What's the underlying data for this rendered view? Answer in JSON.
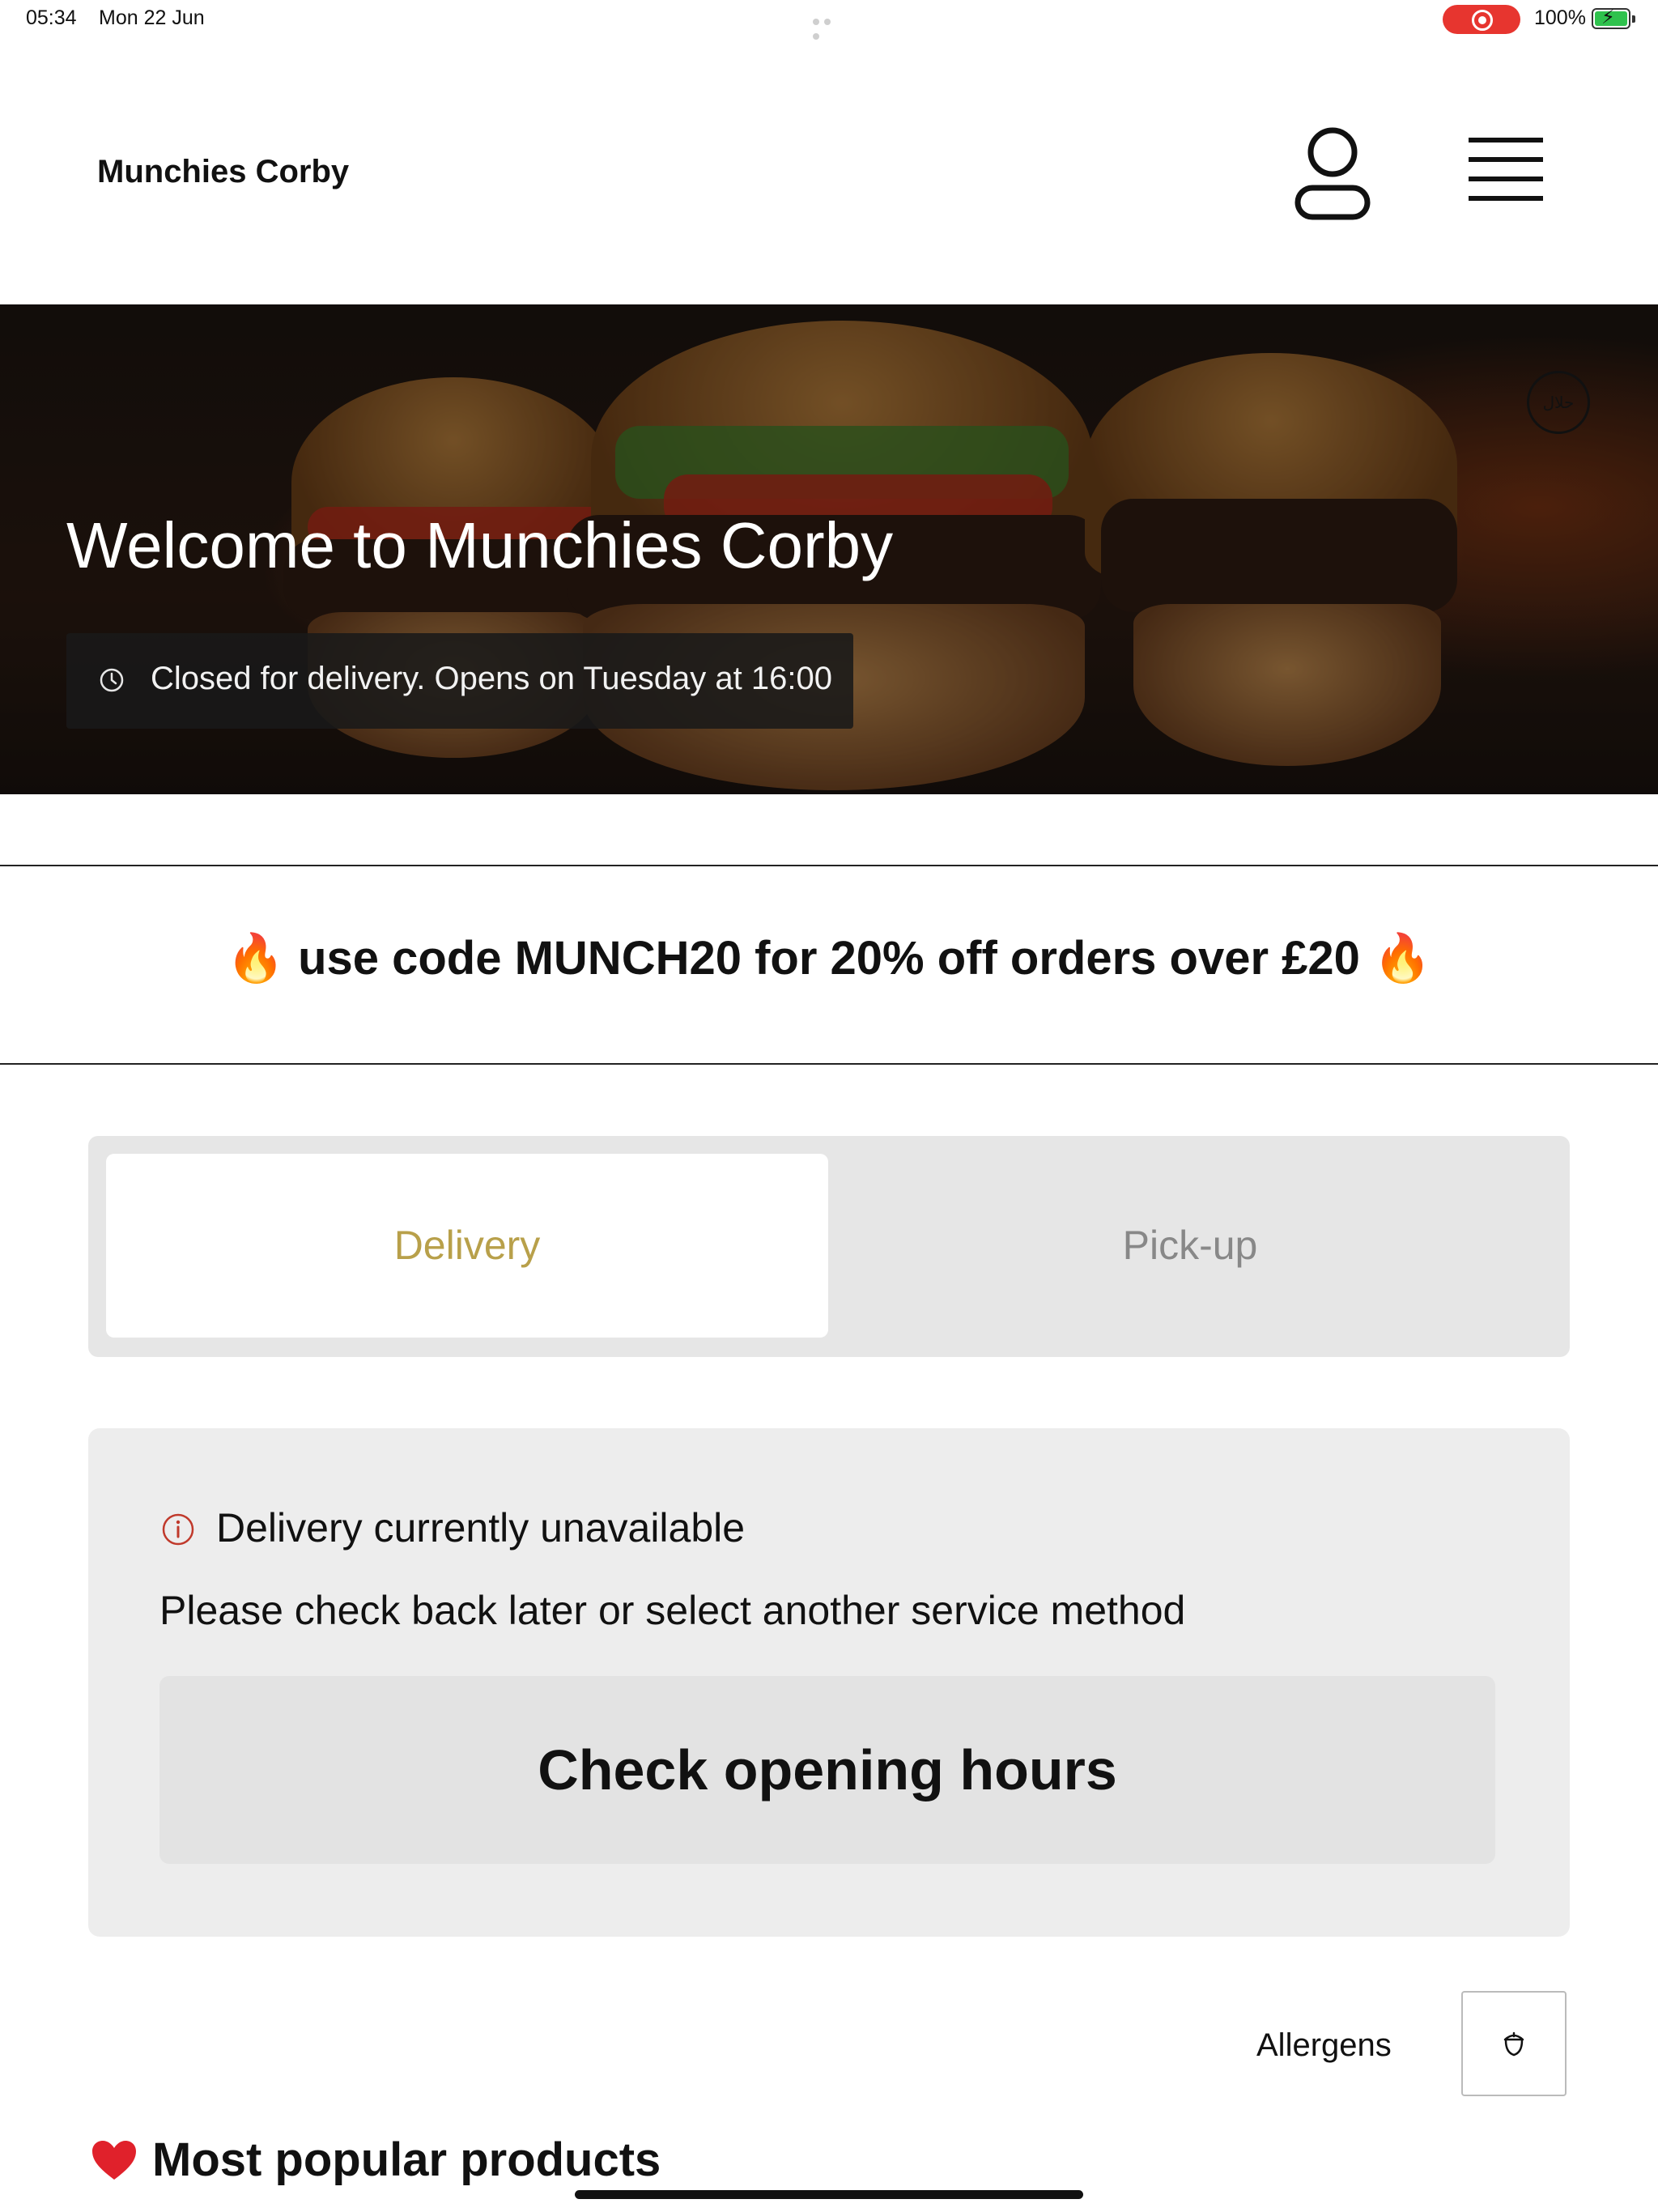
{
  "status_bar": {
    "time": "05:34",
    "date": "Mon 22 Jun",
    "battery": "100%"
  },
  "header": {
    "brand": "Munchies Corby",
    "account_icon": "user-icon",
    "menu_icon": "hamburger-menu-icon"
  },
  "hero": {
    "title": "Welcome to Munchies Corby",
    "status": "Closed for delivery. Opens on Tuesday at 16:00",
    "halal_icon": "halal-badge-icon"
  },
  "promo": {
    "text": "🔥 use code MUNCH20 for 20% off orders over £20 🔥"
  },
  "service": {
    "tabs": [
      {
        "label": "Delivery",
        "selected": true
      },
      {
        "label": "Pick-up",
        "selected": false
      }
    ],
    "active_color": "#b8a04a"
  },
  "notice": {
    "title": "Delivery currently unavailable",
    "description": "Please check back later or select another service method",
    "button": "Check opening hours",
    "icon_color": "#c0392b"
  },
  "allergens": {
    "label": "Allergens",
    "icon": "acorn-icon"
  },
  "popular": {
    "heading": "Most popular products",
    "icon": "heart-icon"
  }
}
